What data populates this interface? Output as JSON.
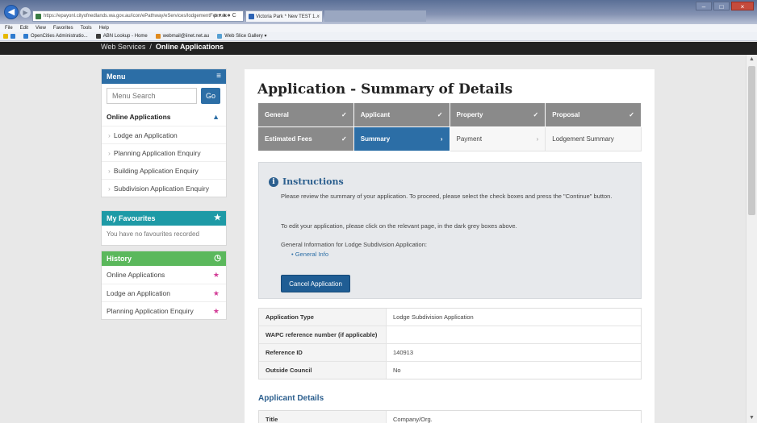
{
  "browser": {
    "address": "https://epayonl.cityofnedlands.wa.gov.au/icon/ePathway/eServices/lodgementFees.do",
    "address_controls": "ρ ▾ ♠ ♦ C",
    "tab_active": "Victoria Park * New TEST 1...",
    "tab_close": "×",
    "tab_inactive": "",
    "window_controls": [
      "–",
      "□",
      "×"
    ],
    "menu": [
      "File",
      "Edit",
      "View",
      "Favorites",
      "Tools",
      "Help"
    ],
    "favorites": [
      {
        "label": "OpenCities Administratio...",
        "color": "#2e7bcf"
      },
      {
        "label": "ABN Lookup - Home",
        "color": "#3a3a3a"
      },
      {
        "label": "webmail@iinet.net.au",
        "color": "#e08a1c"
      },
      {
        "label": "Web Slice Gallery ▾",
        "color": "#56a0d3"
      }
    ]
  },
  "header": {
    "crumbs": [
      "Web Services",
      "Online Applications"
    ],
    "separator": "/"
  },
  "scrollbar": {
    "up": "▲",
    "down": "▼"
  },
  "sidebar": {
    "menu_title": "Menu",
    "menu_icon": "≡",
    "search_placeholder": "Menu Search",
    "go_label": "Go",
    "section_label": "Online Applications",
    "section_icon": "▲",
    "bullet": "›",
    "items": [
      "Lodge an Application",
      "Planning Application Enquiry",
      "Building Application Enquiry",
      "Subdivision Application Enquiry"
    ],
    "favourites_title": "My Favourites",
    "favourites_icon": "★",
    "favourites_empty": "You have no favourites recorded",
    "history_title": "History",
    "history_icon": "◷",
    "history_star": "★",
    "history_items": [
      "Online Applications",
      "Lodge an Application",
      "Planning Application Enquiry"
    ]
  },
  "main": {
    "title": "Application - Summary of Details",
    "steps": [
      {
        "label": "General",
        "state": "done",
        "icon": "✓"
      },
      {
        "label": "Applicant",
        "state": "done",
        "icon": "✓"
      },
      {
        "label": "Property",
        "state": "done",
        "icon": "✓"
      },
      {
        "label": "Proposal",
        "state": "done",
        "icon": "✓"
      },
      {
        "label": "Estimated Fees",
        "state": "done",
        "icon": "✓"
      },
      {
        "label": "Summary",
        "state": "current",
        "icon": "›"
      },
      {
        "label": "Payment",
        "state": "todo",
        "icon": "›"
      },
      {
        "label": "Lodgement Summary",
        "state": "todo",
        "icon": ""
      }
    ],
    "instructions": {
      "title": "Instructions",
      "info_icon": "i",
      "para1": "Please review the summary of your application. To proceed, please select the check boxes and press the \"Continue\" button.",
      "para2": "To edit your application, please click on the relevant page, in the dark grey boxes above.",
      "para3": "General Information for Lodge Subdivision Application:",
      "link": "• General Info",
      "cancel_label": "Cancel Application"
    },
    "details": [
      {
        "label": "Application Type",
        "value": "Lodge Subdivision Application"
      },
      {
        "label": "WAPC reference number (if applicable)",
        "value": ""
      },
      {
        "label": "Reference ID",
        "value": "140913"
      },
      {
        "label": "Outside Council",
        "value": "No"
      }
    ],
    "applicant_title": "Applicant Details",
    "applicant": [
      {
        "label": "Title",
        "value": "Company/Org."
      }
    ]
  }
}
